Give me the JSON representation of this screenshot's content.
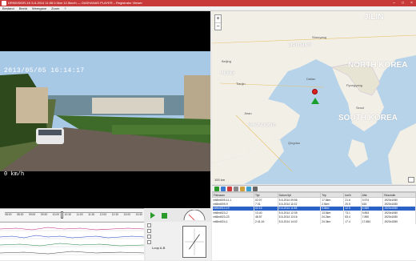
{
  "window": {
    "title": "DR900S/DR-1K 5-5-2014 11:58 0.0km 12.5km/h — DASHANAS PLAYER – Registrator Viewer"
  },
  "menu": [
    "Bestand",
    "Beeld",
    "Weergave",
    "Zoom",
    "?"
  ],
  "video": {
    "timestamp": "2013/05/05 16:14:17",
    "speed": "0 km/h"
  },
  "map": {
    "labels": {
      "jilin": "JILIN",
      "north_korea": "NORTH KOREA",
      "south_korea": "SOUTH KOREA",
      "liaoning": "LIAONING",
      "shandong": "SHANDONG",
      "hebei": "HEBEI",
      "beijing": "Beijing",
      "tianjin": "Tianjin",
      "seoul": "Seoul",
      "pyongyang": "Pyongyang",
      "dalian": "Dalian",
      "qingdao": "Qingdao",
      "shenyang": "Shenyang",
      "jinan": "Jinan"
    },
    "scale": "100 km",
    "zoom_in": "+",
    "zoom_out": "−"
  },
  "table": {
    "headers": [
      "Filenaam",
      "Tijd",
      "Datum tijd",
      "Trip",
      "km/h",
      "Afst.",
      "Resolutie"
    ],
    "rows": [
      [
        "mt8mt009-11-1",
        "02:07",
        "5-5-2014 09:56",
        "17.8km",
        "21.6",
        "3.974",
        "1920x1080"
      ],
      [
        "mt8mt009-9",
        "7:31",
        "5-5-2014 11:02",
        "2.5km",
        "20.5",
        "615",
        "1920x1080"
      ],
      [
        "mt8mt010-19",
        "02:15",
        "5-5-2014 11:58",
        "9.8km",
        "12.5",
        "4.565",
        "1920x1080"
      ],
      [
        "mt8mt023-2",
        "13.40",
        "5-5-2014 12:35",
        "13.5km",
        "73.1",
        "9.853",
        "1920x1080"
      ],
      [
        "mt8mt023-23",
        "48.57",
        "5-5-2014 13:16",
        "24.2km",
        "53.4",
        "7.890",
        "1920x1080"
      ],
      [
        "mt8mt024-1",
        "2:41:16",
        "5-5-2014 14:02",
        "24.3km",
        "17.4",
        "17.684",
        "1920x1080"
      ]
    ],
    "selected": 2
  },
  "timeline": {
    "ticks": [
      "12:08:00",
      "12:08:30",
      "12:09:00",
      "12:09:30",
      "12:10:00",
      "12:10:30",
      "12:11:00",
      "12:11:30",
      "12:12:00",
      "12:12:30",
      "12:13:00",
      "12:13:30"
    ]
  },
  "gauges": {
    "loop_label": "Loop A-B"
  },
  "colors": {
    "title_bar": "#c83a3a",
    "play_green": "#2a9a2a",
    "selection": "#2b62c7",
    "sea": "#b6d3ea",
    "land": "#f2efe6"
  }
}
